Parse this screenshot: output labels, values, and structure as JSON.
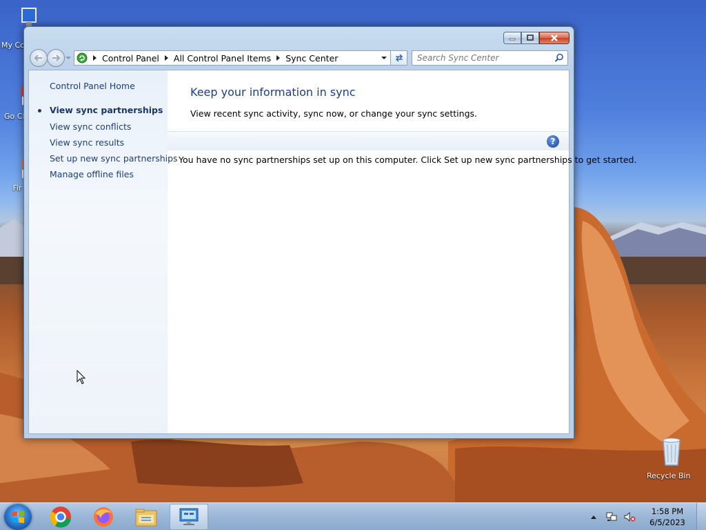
{
  "desktop": {
    "icons": [
      {
        "id": "my-computer",
        "label": "My Co"
      },
      {
        "id": "google-chrome",
        "label": "Go Chr"
      },
      {
        "id": "firefox",
        "label": "Fir"
      },
      {
        "id": "recycle-bin",
        "label": "Recycle Bin"
      }
    ]
  },
  "window": {
    "title": "",
    "address": {
      "crumbs": [
        "Control Panel",
        "All Control Panel Items",
        "Sync Center"
      ]
    },
    "search": {
      "placeholder": "Search Sync Center"
    },
    "left_nav": {
      "home": "Control Panel Home",
      "items": [
        {
          "label": "View sync partnerships",
          "current": true
        },
        {
          "label": "View sync conflicts"
        },
        {
          "label": "View sync results"
        },
        {
          "label": "Set up new sync partnerships"
        },
        {
          "label": "Manage offline files"
        }
      ]
    },
    "main": {
      "title": "Keep your information in sync",
      "subtitle": "View recent sync activity, sync now, or change your sync settings.",
      "help": "?",
      "empty_message": "You have no sync partnerships set up on this computer. Click Set up new sync partnerships to get started."
    }
  },
  "taskbar": {
    "apps": [
      "chrome",
      "firefox",
      "windows-explorer",
      "control-panel"
    ],
    "active_app": "control-panel",
    "clock": {
      "time": "1:58 PM",
      "date": "6/5/2023"
    }
  },
  "colors": {
    "link": "#1e3d7b",
    "heading": "#1e3c84",
    "accent": "#2e5bb4"
  }
}
